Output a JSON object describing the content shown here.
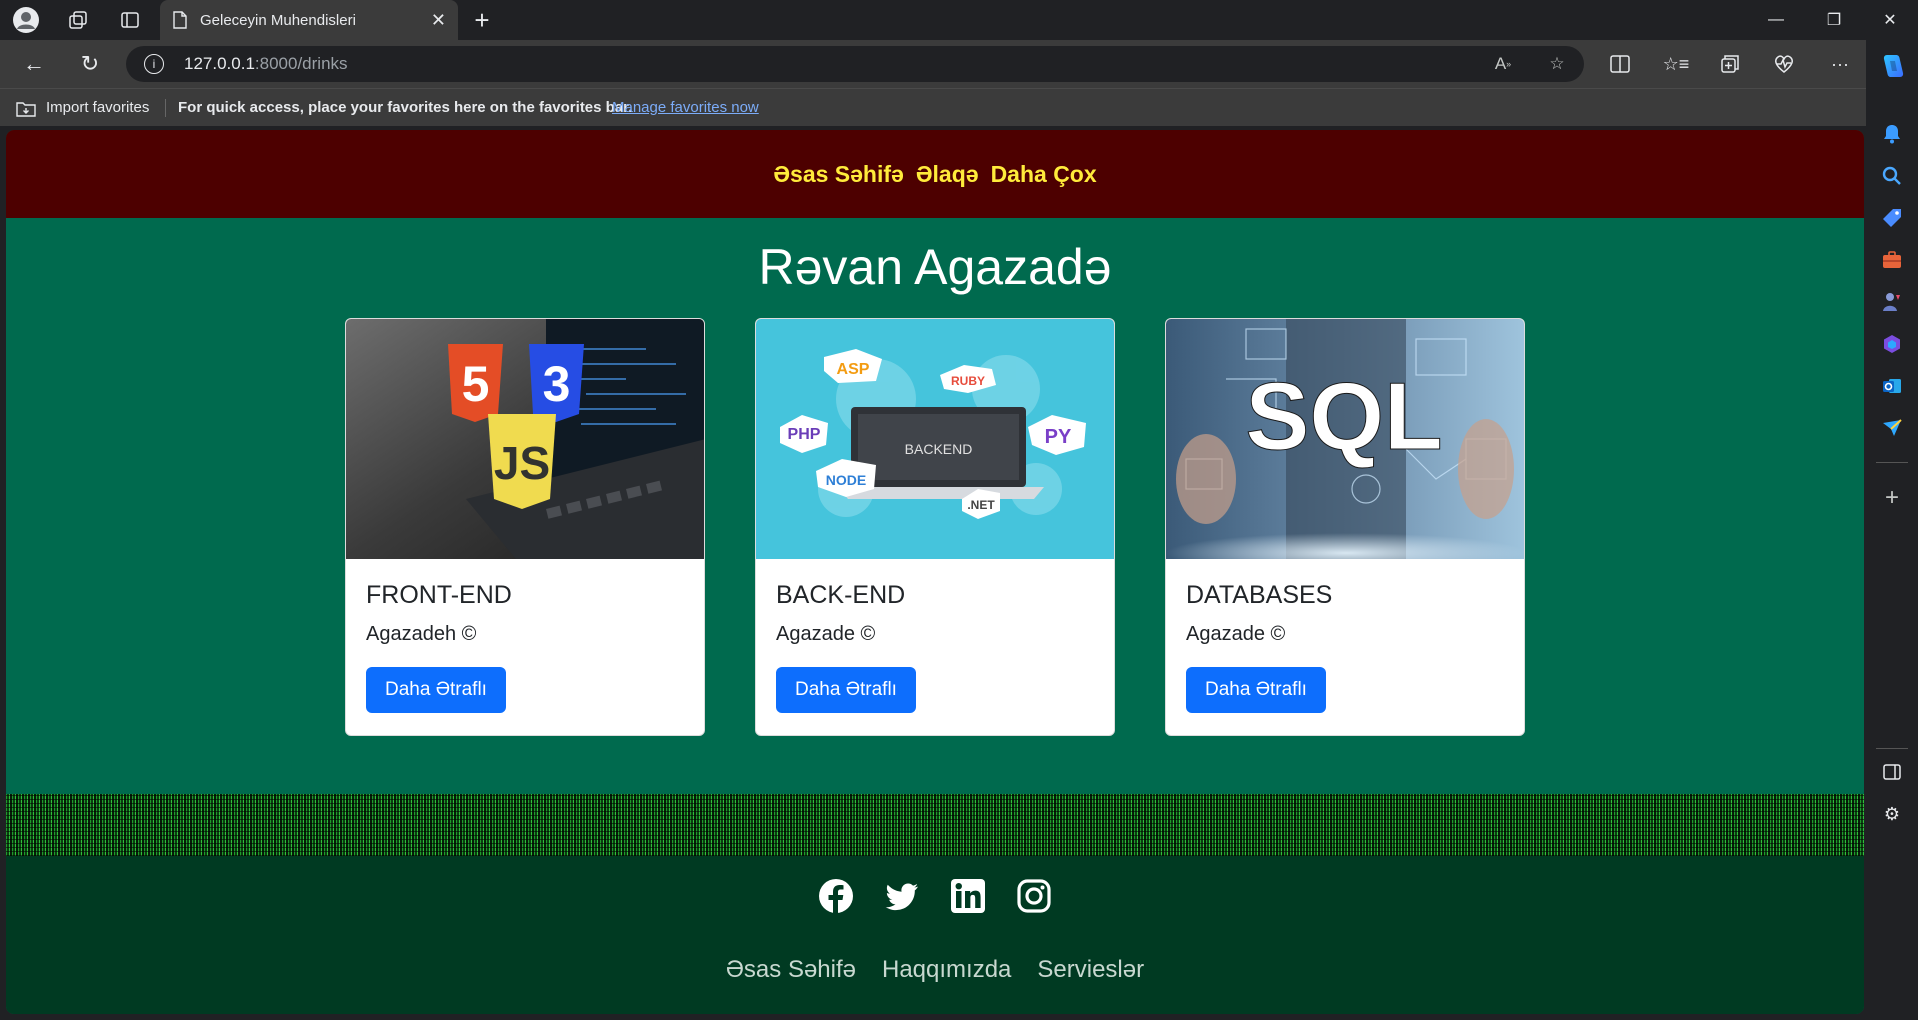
{
  "browser": {
    "tab_title": "Geleceyin Muhendisleri",
    "url_host": "127.0.0.1",
    "url_path": ":8000/drinks",
    "favorites": {
      "import_label": "Import favorites",
      "message": "For quick access, place your favorites here on the favorites bar.",
      "manage_link": "Manage favorites now"
    }
  },
  "site": {
    "nav": [
      "Əsas Səhifə",
      "Əlaqə",
      "Daha Çox"
    ],
    "hero_title": "Rəvan Agazadə",
    "cards": [
      {
        "title": "FRONT-END",
        "text": "Agazadeh ©",
        "button": "Daha Ətraflı",
        "image": "html-css-js-laptop"
      },
      {
        "title": "BACK-END",
        "text": "Agazade ©",
        "button": "Daha Ətraflı",
        "image": "backend-languages"
      },
      {
        "title": "DATABASES",
        "text": "Agazade ©",
        "button": "Daha Ətraflı",
        "image": "sql-hologram"
      }
    ],
    "footer": {
      "social": [
        "facebook-icon",
        "twitter-icon",
        "linkedin-icon",
        "instagram-icon"
      ],
      "links": [
        "Əsas Səhifə",
        "Haqqımızda",
        "Servieslər"
      ]
    },
    "colors": {
      "nav_bg": "#4d0000",
      "nav_text": "#ffeb3b",
      "page_bg": "#006a4e",
      "footer_bg": "#003a22",
      "button": "#0d6efd"
    }
  },
  "thumb_text": {
    "fe_html": "5",
    "fe_css": "3",
    "fe_js": "JS",
    "be_center": "BACKEND",
    "be_asp": "ASP",
    "be_ruby": "RUBY",
    "be_php": "PHP",
    "be_py": "PY",
    "be_node": "NODE",
    "be_net": ".NET",
    "db_sql": "SQL"
  }
}
